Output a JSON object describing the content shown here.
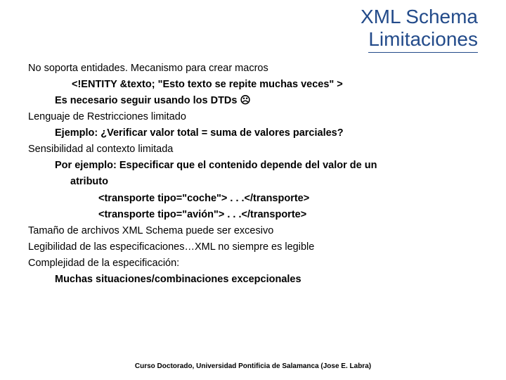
{
  "title": {
    "line1": "XML Schema",
    "line2": "Limitaciones"
  },
  "body": {
    "l1": "No soporta entidades. Mecanismo para crear macros",
    "l2": "<!ENTITY &texto;  \"Esto texto se repite muchas veces\" >",
    "l3": "Es necesario seguir usando los DTDs  ☹",
    "l4": "Lenguaje de Restricciones limitado",
    "l5": "Ejemplo: ¿Verificar valor total = suma de valores parciales?",
    "l6": "Sensibilidad al contexto limitada",
    "l7": "Por ejemplo: Especificar que el contenido depende del valor de un",
    "l7b": "atributo",
    "l8": "<transporte tipo=\"coche\"> . . .</transporte>",
    "l9": "<transporte tipo=\"avión\"> . . .</transporte>",
    "l10": "Tamaño de archivos XML Schema puede ser excesivo",
    "l11": "Legibilidad de las especificaciones…XML no siempre es legible",
    "l12": "Complejidad de la especificación:",
    "l13": "Muchas situaciones/combinaciones excepcionales"
  },
  "footer": "Curso Doctorado, Universidad Pontificia de Salamanca (Jose E. Labra)"
}
